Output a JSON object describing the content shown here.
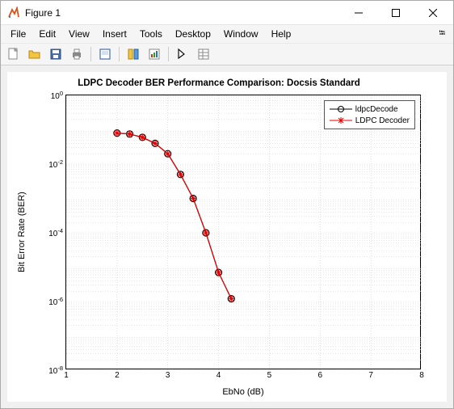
{
  "window": {
    "title": "Figure 1"
  },
  "menubar": {
    "items": [
      "File",
      "Edit",
      "View",
      "Insert",
      "Tools",
      "Desktop",
      "Window",
      "Help"
    ]
  },
  "chart_data": {
    "type": "line",
    "title": "LDPC Decoder BER Performance Comparison: Docsis Standard",
    "xlabel": "EbNo (dB)",
    "ylabel": "Bit Error Rate (BER)",
    "xlim": [
      1,
      8
    ],
    "ylim": [
      1e-08,
      1
    ],
    "xticks": [
      1,
      2,
      3,
      4,
      5,
      6,
      7,
      8
    ],
    "yticks_exp": [
      0,
      -2,
      -4,
      -6,
      -8
    ],
    "x": [
      2.0,
      2.25,
      2.5,
      2.75,
      3.0,
      3.25,
      3.5,
      3.75,
      4.0,
      4.25
    ],
    "series": [
      {
        "name": "ldpcDecode",
        "color": "#000000",
        "marker": "o",
        "values": [
          0.08,
          0.075,
          0.06,
          0.04,
          0.02,
          0.005,
          0.001,
          0.0001,
          7e-06,
          1.2e-06
        ]
      },
      {
        "name": "LDPC Decoder",
        "color": "#e60000",
        "marker": "*",
        "values": [
          0.08,
          0.075,
          0.06,
          0.04,
          0.02,
          0.005,
          0.001,
          0.0001,
          7e-06,
          1.2e-06
        ]
      }
    ],
    "legend_position": "upper right"
  }
}
